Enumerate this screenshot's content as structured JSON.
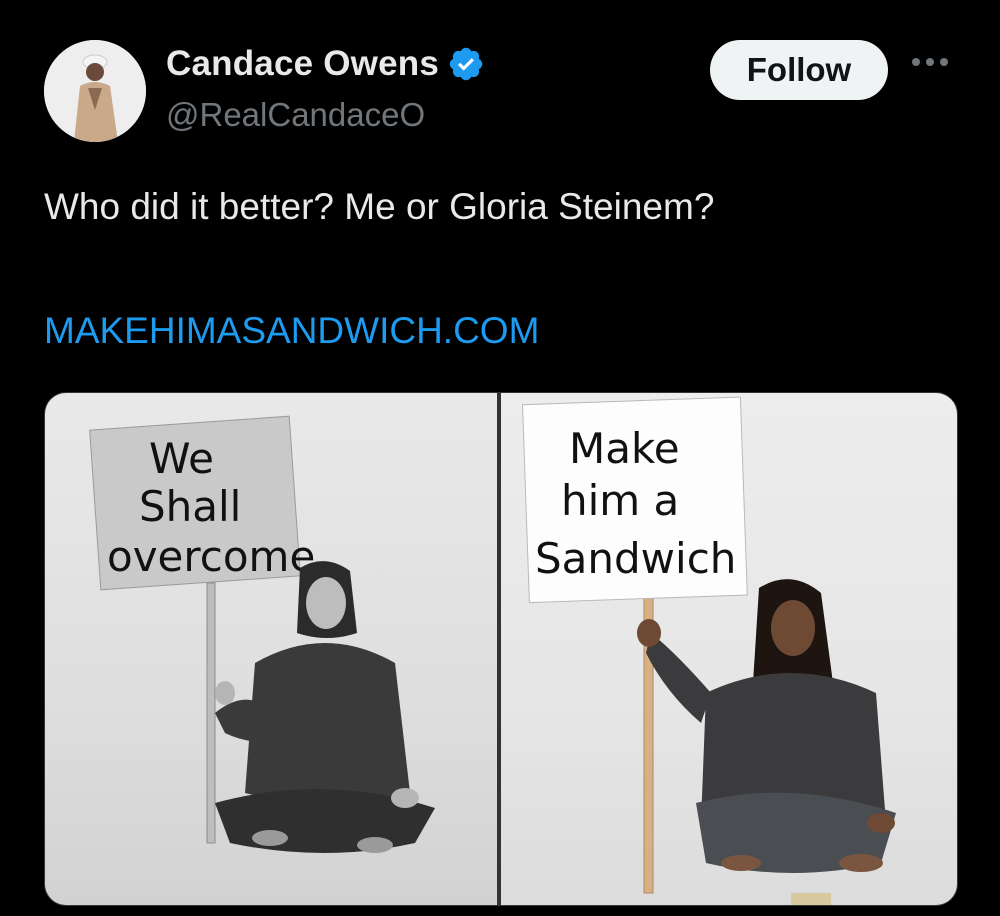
{
  "author": {
    "name": "Candace Owens",
    "handle": "@RealCandaceO",
    "verified_icon": "verified-badge-icon",
    "accent_color": "#1d9bf0"
  },
  "actions": {
    "follow_label": "Follow",
    "more_icon": "more-horizontal-icon"
  },
  "tweet": {
    "text": "Who did it better? Me or Gloria Steinem?",
    "link_text": "MAKEHIMASANDWICH.COM"
  },
  "media": {
    "left_sign": {
      "line1": "We",
      "line2": "Shall",
      "line3": "overcome"
    },
    "right_sign": {
      "line1": "Make",
      "line2": "him a",
      "line3": "Sandwich"
    }
  }
}
